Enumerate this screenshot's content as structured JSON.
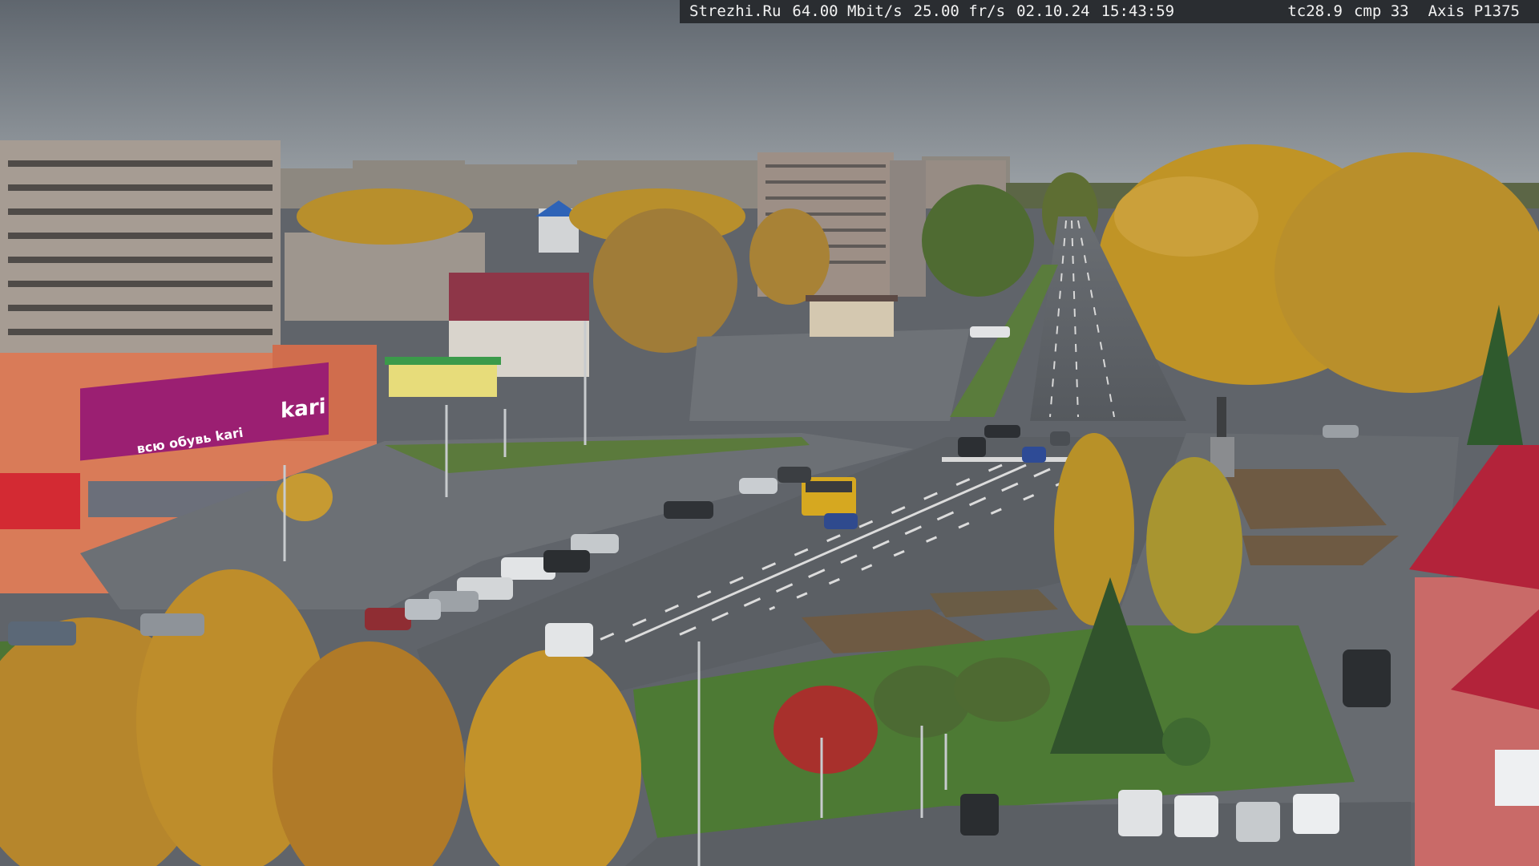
{
  "overlay": {
    "site": "Strezhi.Ru",
    "bitrate": "64.00 Mbit/s",
    "framerate": "25.00 fr/s",
    "date": "02.10.24",
    "time": "15:43:59",
    "temperature": "tc28.9",
    "compression": "cmp 33",
    "camera_model": "Axis P1375"
  },
  "signs": {
    "store_logo": "kari",
    "store_banner": "всю обувь kari"
  },
  "colors": {
    "sky": "#7d848b",
    "foliage_yellow": "#c8962a",
    "asphalt": "#5d6166",
    "grass": "#4d7a34",
    "store_banner": "#9b1f72",
    "roof_red": "#b3233a"
  }
}
